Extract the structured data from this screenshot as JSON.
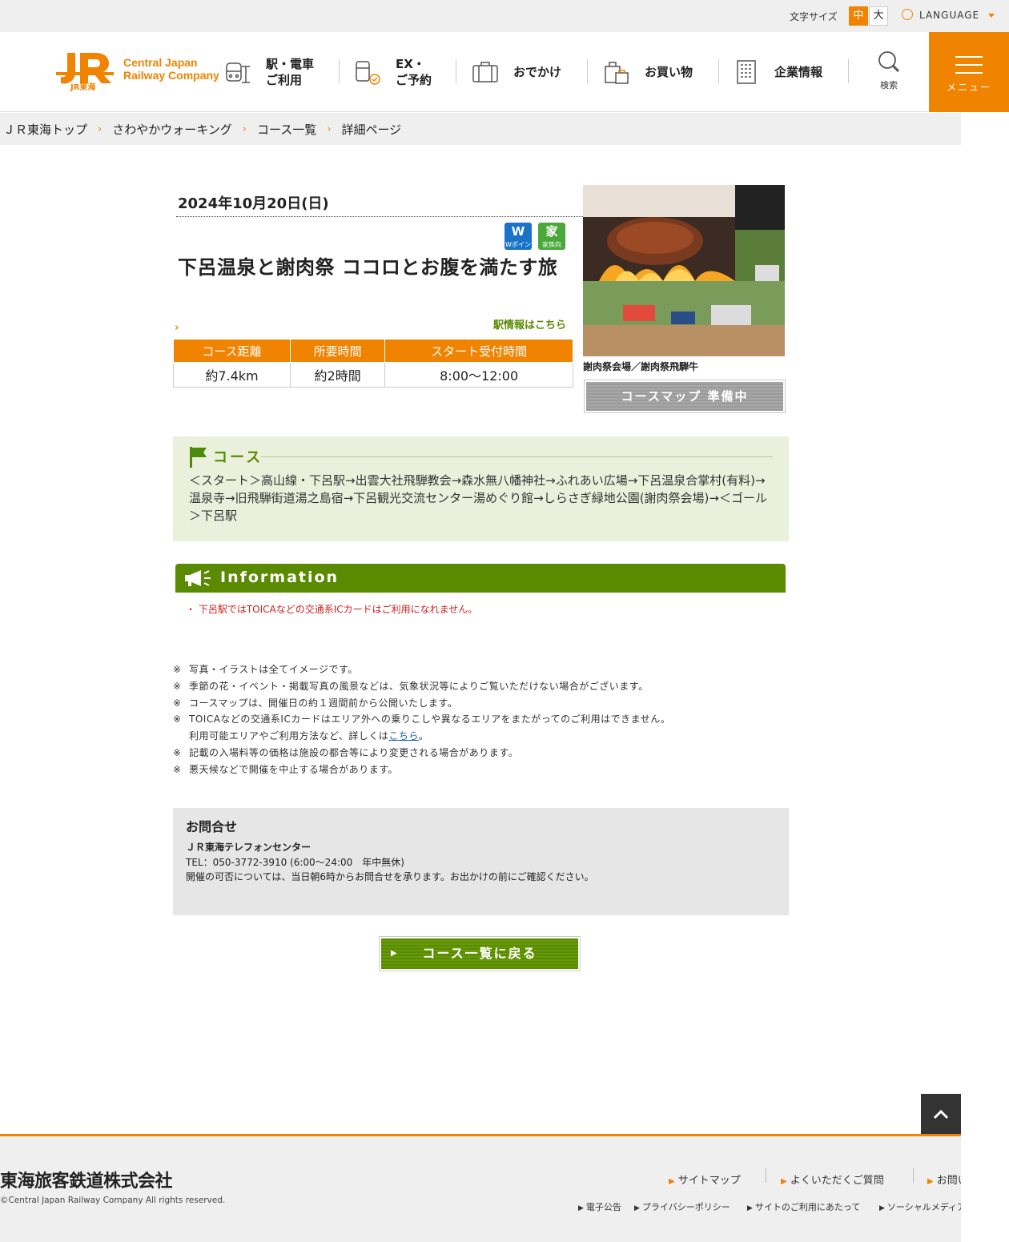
{
  "utility": {
    "font_size_label": "文字サイズ",
    "font_size_medium": "中",
    "font_size_large": "大",
    "language_label": "LANGUAGE"
  },
  "header": {
    "logo_lines": [
      "Central Japan",
      "Railway Company"
    ],
    "logo_sub": "JR東海",
    "nav": [
      {
        "label": "駅・電車\nご利用",
        "icon": "train-station-icon"
      },
      {
        "label": "EX・\nご予約",
        "icon": "reservation-icon"
      },
      {
        "label": "おでかけ",
        "icon": "suitcase-icon"
      },
      {
        "label": "お買い物",
        "icon": "shopping-bag-icon"
      },
      {
        "label": "企業情報",
        "icon": "building-icon"
      }
    ],
    "search_label": "検索",
    "menu_label": "メニュー"
  },
  "breadcrumb": [
    "ＪＲ東海トップ",
    "さわやかウォーキング",
    "コース一覧",
    "詳細ページ"
  ],
  "event": {
    "date": "2024年10月20日(日)",
    "badges": [
      {
        "symbol": "W",
        "label": "Wポイント",
        "color": "#1a73c8"
      },
      {
        "symbol": "家",
        "label": "家族向",
        "color": "#4aa83a"
      }
    ],
    "title": "下呂温泉と謝肉祭 ココロとお腹を満たす旅",
    "station_link": "駅情報はこちら",
    "table_headers": [
      "コース距離",
      "所要時間",
      "スタート受付時間"
    ],
    "table_values": [
      "約7.4km",
      "約2時間",
      "8:00～12:00"
    ],
    "photo_caption": "謝肉祭会場／謝肉祭飛騨牛",
    "map_button": "コースマップ 準備中"
  },
  "course": {
    "heading": "コース",
    "route": "＜スタート＞高山線・下呂駅→出雲大社飛騨教会→森水無八幡神社→ふれあい広場→下呂温泉合掌村(有料)→温泉寺→旧飛騨街道湯之島宿→下呂観光交流センター湯めぐり館→しらさぎ緑地公園(謝肉祭会場)→＜ゴール＞下呂駅"
  },
  "information": {
    "heading": "Information",
    "items": [
      "下呂駅ではTOICAなどの交通系ICカードはご利用になれません。"
    ]
  },
  "notes": {
    "mark": "※",
    "items": [
      "写真・イラストは全てイメージです。",
      "季節の花・イベント・掲載写真の風景などは、気象状況等によりご覧いただけない場合がございます。",
      "コースマップは、開催日の約１週間前から公開いたします。",
      "TOICAなどの交通系ICカードはエリア外への乗りこしや異なるエリアをまたがってのご利用はできません。"
    ],
    "toica_cont_prefix": "利用可能エリアやご利用方法など、詳しくは",
    "toica_link": "こちら",
    "toica_cont_suffix": "。",
    "items2": [
      "記載の入場料等の価格は施設の都合等により変更される場合があります。",
      "悪天候などで開催を中止する場合があります。"
    ]
  },
  "contact": {
    "heading": "お問合せ",
    "name": "ＪＲ東海テレフォンセンター",
    "tel": "TEL：050-3772-3910 (6:00～24:00　年中無休)",
    "message": "開催の可否については、当日朝6時からお問合せを承ります。お出かけの前にご確認ください。"
  },
  "back_button": "コース一覧に戻る",
  "footer": {
    "corp_name": "東海旅客鉄道株式会社",
    "copyright": "©Central Japan Railway Company All rights reserved.",
    "links": [
      "サイトマップ",
      "よくいただくご質問",
      "お問い合わせ"
    ],
    "sub_links": [
      "電子公告",
      "プライバシーポリシー",
      "サイトのご利用にあたって",
      "ソーシャルメディアについて"
    ]
  },
  "colors": {
    "brand_orange": "#f08300",
    "course_green": "#5a8a00",
    "alert_red": "#d02020"
  }
}
